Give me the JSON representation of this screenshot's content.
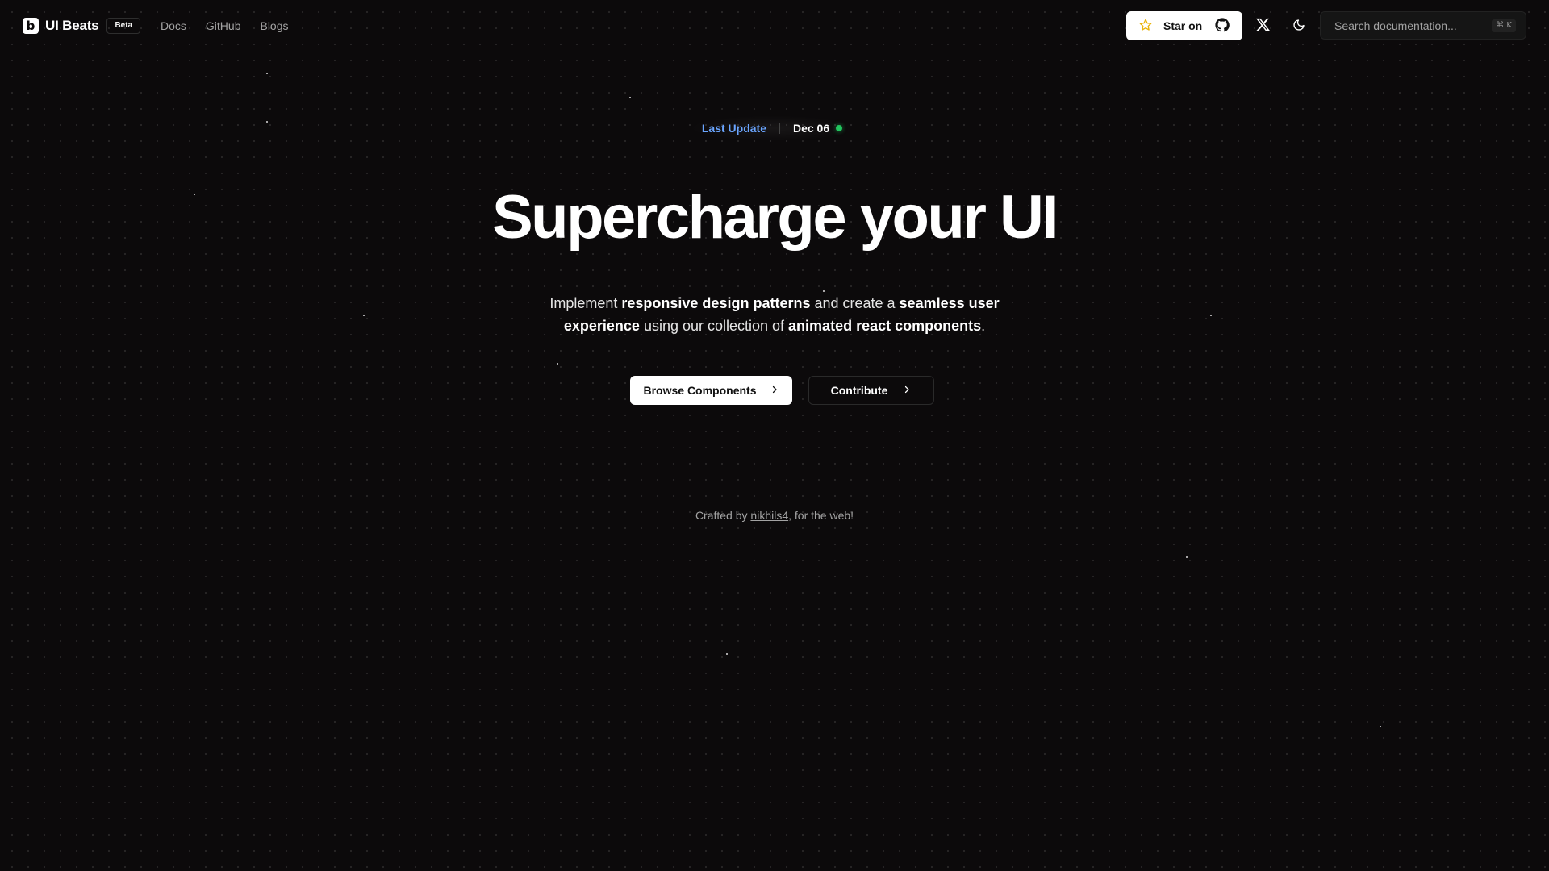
{
  "brand": {
    "logo_letter": "b",
    "name": "UI Beats",
    "badge": "Beta"
  },
  "nav": {
    "links": [
      "Docs",
      "GitHub",
      "Blogs"
    ]
  },
  "header": {
    "star_label": "Star on",
    "star_icon": "star-icon",
    "github_icon": "github-icon",
    "x_icon": "x-icon",
    "theme_icon": "moon-icon",
    "search_placeholder": "Search documentation...",
    "search_shortcut": "⌘ K"
  },
  "hero": {
    "update_label": "Last Update",
    "update_date": "Dec 06",
    "update_status_color": "#22c55e",
    "title": "Supercharge your UI",
    "subtitle": {
      "p1": "Implement ",
      "b1": "responsive design patterns",
      "p2": " and create a ",
      "b2": "seamless user experience",
      "p3": " using our collection of ",
      "b3": "animated react components",
      "p4": "."
    },
    "primary_cta": "Browse Components",
    "secondary_cta": "Contribute"
  },
  "footer": {
    "prefix": "Crafted by ",
    "author": "nikhils4",
    "suffix": ", for the web!"
  },
  "colors": {
    "background": "#0c0a0b",
    "accent_blue": "#6aa5ff",
    "status_green": "#22c55e"
  }
}
